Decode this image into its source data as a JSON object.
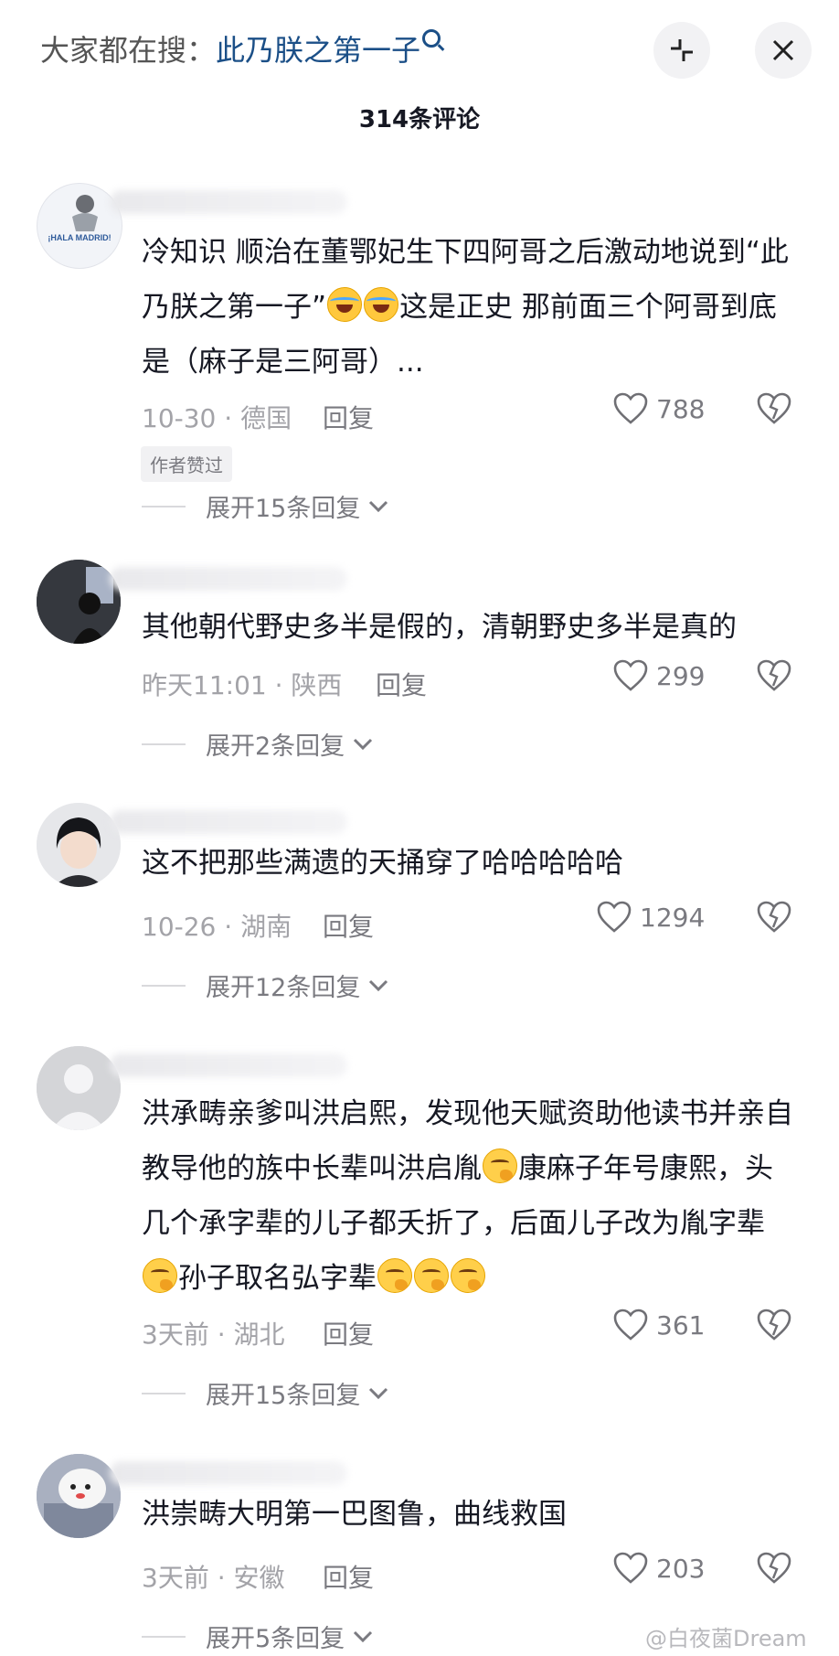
{
  "header": {
    "search_prefix": "大家都在搜：",
    "search_term": "此乃朕之第一子",
    "comment_count": "314条评论"
  },
  "comments": [
    {
      "text_parts": [
        "冷知识 顺治在董鄂妃生下四阿哥之后激动地说到“此乃朕之第一子”",
        "这是正史 那前面三个阿哥到底是（麻子是三阿哥）..."
      ],
      "meta": "10-30 · 德国",
      "reply_label": "回复",
      "likes": "788",
      "badge": "作者赞过",
      "expand": "展开15条回复",
      "avatar_text": "¡HALA MADRID!"
    },
    {
      "text": "其他朝代野史多半是假的，清朝野史多半是真的",
      "meta": "昨天11:01 · 陕西",
      "reply_label": "回复",
      "likes": "299",
      "expand": "展开2条回复"
    },
    {
      "text": "这不把那些满遗的天捅穿了哈哈哈哈哈",
      "meta": "10-26 · 湖南",
      "reply_label": "回复",
      "likes": "1294",
      "expand": "展开12条回复"
    },
    {
      "text_parts": [
        "洪承畴亲爹叫洪启熙，发现他天赋资助他读书并亲自教导他的族中长辈叫洪启胤",
        "康麻子年号康熙，头几个承字辈的儿子都夭折了，后面儿子改为胤字辈",
        "孙子取名弘字辈"
      ],
      "meta": "3天前 · 湖北",
      "reply_label": "回复",
      "likes": "361",
      "expand": "展开15条回复"
    },
    {
      "text": "洪崇畴大明第一巴图鲁，曲线救国",
      "meta": "3天前 · 安徽",
      "reply_label": "回复",
      "likes": "203",
      "expand": "展开5条回复"
    }
  ],
  "watermark": "@白夜菌Dream",
  "colors": {
    "search_term": "#1b4f87",
    "meta": "#a3a3a8",
    "text": "#161823"
  }
}
